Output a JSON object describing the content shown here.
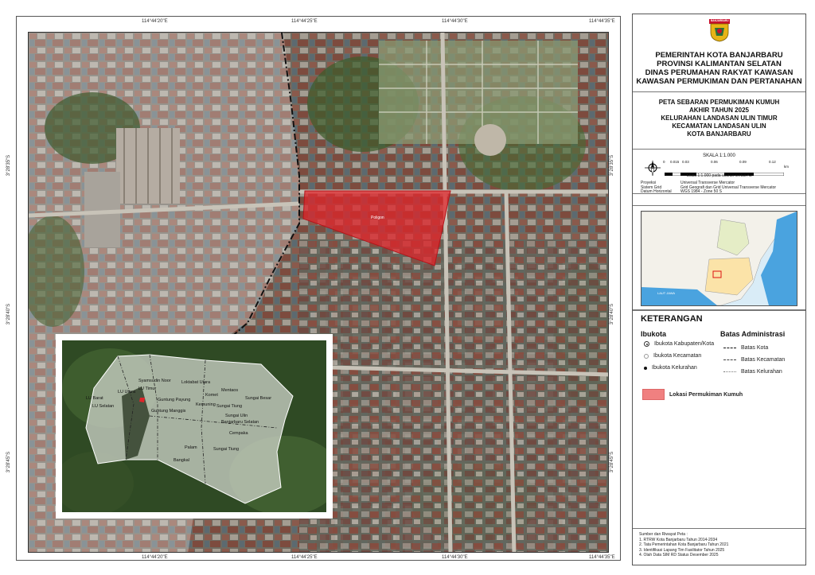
{
  "coords": {
    "top": [
      "114°44'20\"E",
      "114°44'25\"E",
      "114°44'30\"E",
      "114°44'35\"E"
    ],
    "bottom": [
      "114°44'20\"E",
      "114°44'25\"E",
      "114°44'30\"E",
      "114°44'35\"E"
    ],
    "left": [
      "3°28'35\"S",
      "3°28'40\"S",
      "3°28'45\"S"
    ],
    "right": [
      "3°28'35\"S",
      "3°28'40\"S",
      "3°28'45\"S"
    ]
  },
  "map": {
    "polygon_label": "Poligon"
  },
  "inset_labels": [
    "LU Barat",
    "LU Utara",
    "Syamsudin Noor",
    "LU Timur",
    "LU Selatan",
    "Guntung Payung",
    "Guntung Manggis",
    "Sungai Tiung",
    "Sungai Ulin",
    "Loktabat Utara",
    "Komet",
    "Mentaos",
    "Kemuning",
    "Sungai Besar",
    "Banjarbaru Selatan",
    "Cempaka",
    "Palam",
    "Bangkal",
    "Sungai Tiung"
  ],
  "panel": {
    "logo_text": "BANJARBARU",
    "org_lines": [
      "PEMERINTAH KOTA BANJARBARU",
      "PROVINSI KALIMANTAN SELATAN",
      "DINAS PERUMAHAN RAKYAT KAWASAN",
      "KAWASAN PERMUKIMAN DAN PERTANAHAN"
    ],
    "title_lines": [
      "PETA SEBARAN PERMUKIMAN KUMUH",
      "AKHIR TAHUN 2025"
    ],
    "subtitle_lines": [
      "KELURAHAN LANDASAN ULIN TIMUR",
      "KECAMATAN LANDASAN ULIN",
      "KOTA BANJARBARU"
    ],
    "scale": {
      "label": "SKALA",
      "value": "1:1.000",
      "ticks": [
        "0",
        "0.015",
        "0.03",
        "0.06",
        "0.09",
        "0.12"
      ],
      "unit": "km",
      "note": "Skala 1:1.000       pada ukuran kertas A1"
    },
    "projection": [
      {
        "k": "Proyeksi",
        "v": "Universal Transverse Mercator"
      },
      {
        "k": "Sistem Grid",
        "v": "Grid Geografi dan Grid Universal Transverse Mercator"
      },
      {
        "k": "Datum Horizontal",
        "v": "WGS 1984 - Zone 50 S"
      }
    ],
    "overview_sea_label": "LAUT JAWA",
    "legend": {
      "heading": "KETERANGAN",
      "ibukota_head": "Ibukota",
      "batas_head": "Batas Administrasi",
      "ibukota_items": [
        "Ibukota Kabupaten/Kota",
        "Ibukota Kecamatan",
        "Ibukota Kelurahan"
      ],
      "batas_items": [
        "Batas Kota",
        "Batas Kecamatan",
        "Batas Kelurahan"
      ],
      "slum_label": "Lokasi Permukiman Kumuh",
      "slum_color": "#f08080"
    },
    "sources": [
      "Sumber dan Riwayat Peta :",
      "1. RTRW Kota Banjarbaru Tahun 2014-2034",
      "2. Tata Pemerintahan Kota Banjarbaru Tahun 2021",
      "3. Identifikasi Lapang Tim Fasilitator Tahun 2025",
      "4. Olah Data SIM RD Status Desember 2025"
    ]
  },
  "colors": {
    "polygon": "#e0242a",
    "boundary": "#222222"
  }
}
